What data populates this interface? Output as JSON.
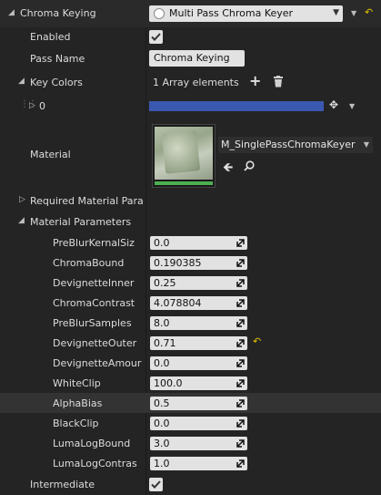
{
  "header": {
    "label": "Chroma Keying",
    "dropdown_value": "Multi Pass Chroma Keyer"
  },
  "enabled": {
    "label": "Enabled",
    "checked": true
  },
  "pass_name": {
    "label": "Pass Name",
    "value": "Chroma Keying"
  },
  "key_colors": {
    "label": "Key Colors",
    "count_text": "1 Array elements",
    "element_index": "0",
    "color": "#3a58b0"
  },
  "material": {
    "label": "Material",
    "asset_name": "M_SinglePassChromaKeyer"
  },
  "required_params": {
    "label": "Required Material Param"
  },
  "material_params": {
    "label": "Material Parameters",
    "items": [
      {
        "name": "PreBlurKernalSiz",
        "value": "0.0"
      },
      {
        "name": "ChromaBound",
        "value": "0.190385"
      },
      {
        "name": "DevignetteInner",
        "value": "0.25"
      },
      {
        "name": "ChromaContrast",
        "value": "4.078804"
      },
      {
        "name": "PreBlurSamples",
        "value": "8.0"
      },
      {
        "name": "DevignetteOuter",
        "value": "0.71"
      },
      {
        "name": "DevignetteAmour",
        "value": "0.0"
      },
      {
        "name": "WhiteClip",
        "value": "100.0"
      },
      {
        "name": "AlphaBias",
        "value": "0.5"
      },
      {
        "name": "BlackClip",
        "value": "0.0"
      },
      {
        "name": "LumaLogBound",
        "value": "3.0"
      },
      {
        "name": "LumaLogContras",
        "value": "1.0"
      }
    ]
  },
  "intermediate": {
    "label": "Intermediate",
    "checked": true
  },
  "colors": {
    "background": "#242424",
    "highlight_row": "#333333",
    "reset_arrow": "#e0c200",
    "key_color": "#3a58b0"
  }
}
